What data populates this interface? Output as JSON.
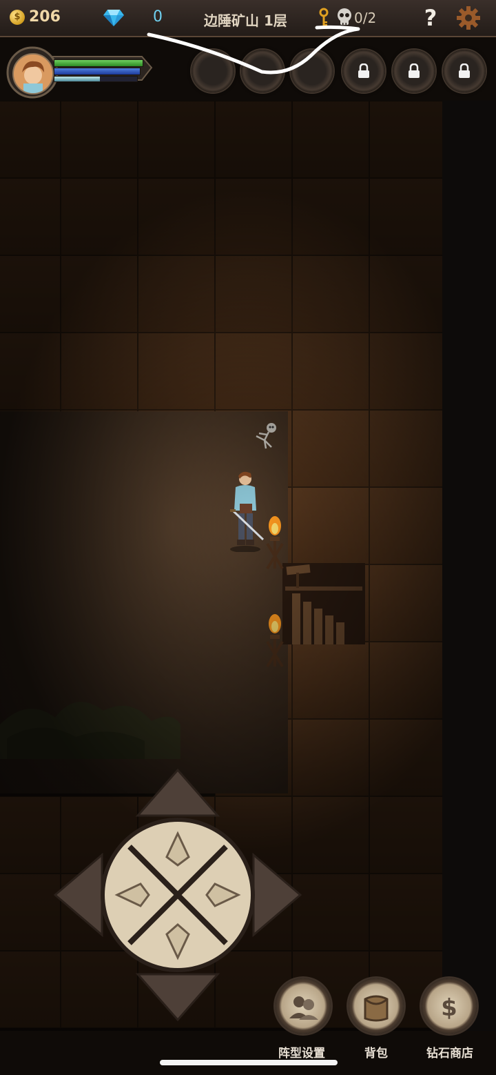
{
  "topbar": {
    "coins": "206",
    "gems": "0",
    "floor_title": "边陲矿山 1层",
    "kills": "0/2",
    "help_label": "?",
    "icons": [
      "coin-icon",
      "gem-icon",
      "key-icon",
      "skull-icon",
      "gear-icon"
    ]
  },
  "hero": {
    "hp_fraction": 1.0,
    "mp_fraction": 1.0,
    "xp_fraction": 0.55
  },
  "skill_slots": [
    {
      "state": "empty"
    },
    {
      "state": "empty"
    },
    {
      "state": "empty"
    },
    {
      "state": "locked"
    },
    {
      "state": "locked"
    },
    {
      "state": "locked"
    }
  ],
  "bottom_menu": {
    "formation_label": "阵型设置",
    "bag_label": "背包",
    "shop_label": "钻石商店"
  },
  "colors": {
    "hp": "#3fa83a",
    "mp": "#2e55c0",
    "gem": "#56c8f0",
    "coin": "#d4a020",
    "wall": "#5b3a20"
  }
}
